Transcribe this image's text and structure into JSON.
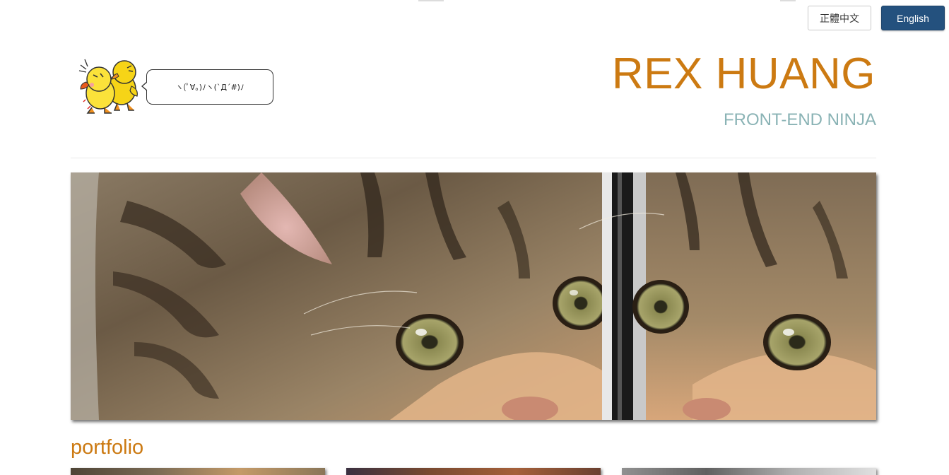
{
  "lang_switch": {
    "zh_label": "正體中文",
    "en_label": "English",
    "active": "English"
  },
  "mascot": {
    "speech": "ヽ(ﾟ∀。)ﾉヽ(`Д´#)ﾉ"
  },
  "header": {
    "name": "REX HUANG",
    "tagline": "FRONT-END NINJA"
  },
  "sections": {
    "portfolio_title": "portfolio"
  },
  "colors": {
    "accent": "#cc7a12",
    "tagline": "#8ab3b5",
    "active_button": "#24517e"
  }
}
